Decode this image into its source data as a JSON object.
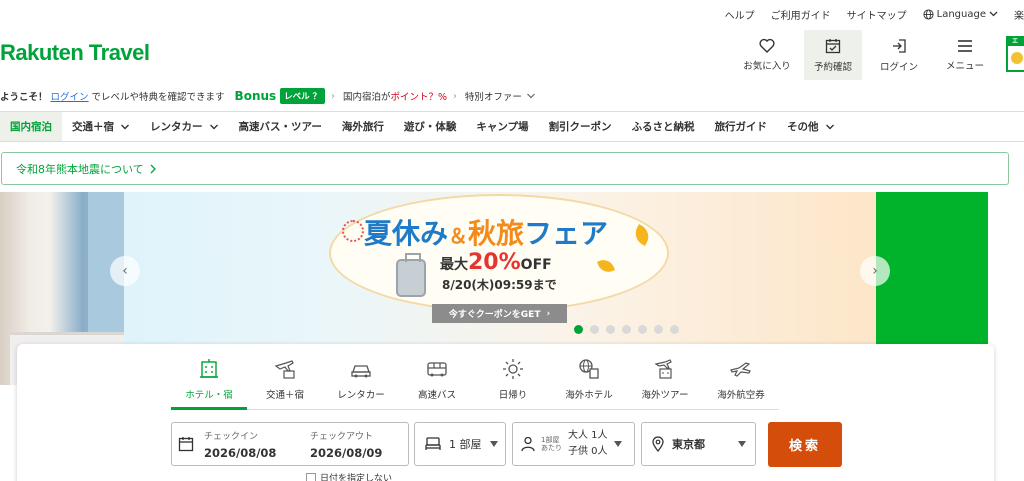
{
  "util_bar": {
    "help": "ヘルプ",
    "guide": "ご利用ガイド",
    "sitemap": "サイトマップ",
    "language": "Language",
    "cut_text": "楽"
  },
  "logo": "Rakuten Travel",
  "header_icons": [
    {
      "label": "お気に入り",
      "icon": "heart-icon"
    },
    {
      "label": "予約確認",
      "icon": "calendar-check-icon"
    },
    {
      "label": "ログイン",
      "icon": "login-icon"
    },
    {
      "label": "メニュー",
      "icon": "menu-icon"
    }
  ],
  "promo_corner_text": "エ",
  "welcome": {
    "greeting": "ようこそ！",
    "login_link": "ログイン",
    "desc": "でレベルや特典を確認できます",
    "bonus": "Bonus",
    "level": "レベル ？",
    "points_prefix": "国内宿泊が",
    "points_red": "ポイント？%",
    "special": "特別オファー"
  },
  "nav": [
    {
      "label": "国内宿泊",
      "active": true,
      "chevron": false
    },
    {
      "label": "交通＋宿",
      "chevron": true
    },
    {
      "label": "レンタカー",
      "chevron": true
    },
    {
      "label": "高速バス・ツアー",
      "chevron": false
    },
    {
      "label": "海外旅行",
      "chevron": false
    },
    {
      "label": "遊び・体験",
      "chevron": false
    },
    {
      "label": "キャンプ場",
      "chevron": false
    },
    {
      "label": "割引クーポン",
      "chevron": false
    },
    {
      "label": "ふるさと納税",
      "chevron": false
    },
    {
      "label": "旅行ガイド",
      "chevron": false
    },
    {
      "label": "その他",
      "chevron": true
    }
  ],
  "notice": "令和8年熊本地震について",
  "banner": {
    "title_a": "夏休み",
    "amp": "＆",
    "title_b": "秋旅",
    "title_c": "フェア",
    "discount_prefix": "最大",
    "discount_pct": "20%",
    "discount_suffix": "OFF",
    "until": "8/20(木)09:59まで",
    "cta": "今すぐクーポンをGET",
    "slide_count": 7,
    "active_slide": 0
  },
  "search": {
    "tabs": [
      {
        "label": "ホテル・宿",
        "icon": "hotel-icon",
        "active": true
      },
      {
        "label": "交通＋宿",
        "icon": "plane-hotel-icon"
      },
      {
        "label": "レンタカー",
        "icon": "car-icon"
      },
      {
        "label": "高速バス",
        "icon": "bus-icon"
      },
      {
        "label": "日帰り",
        "icon": "sun-icon"
      },
      {
        "label": "海外ホテル",
        "icon": "globe-hotel-icon"
      },
      {
        "label": "海外ツアー",
        "icon": "plane-building-icon"
      },
      {
        "label": "海外航空券",
        "icon": "airplane-icon"
      }
    ],
    "checkin_label": "チェックイン",
    "checkin_value": "2026/08/08",
    "checkout_label": "チェックアウト",
    "checkout_value": "2026/08/09",
    "rooms": "1 部屋",
    "per_room_a": "1部屋",
    "per_room_b": "あたり",
    "adults": "大人 1人",
    "children": "子供 0人",
    "area": "東京都",
    "search_button": "検索",
    "no_date": "日付を指定しない"
  }
}
